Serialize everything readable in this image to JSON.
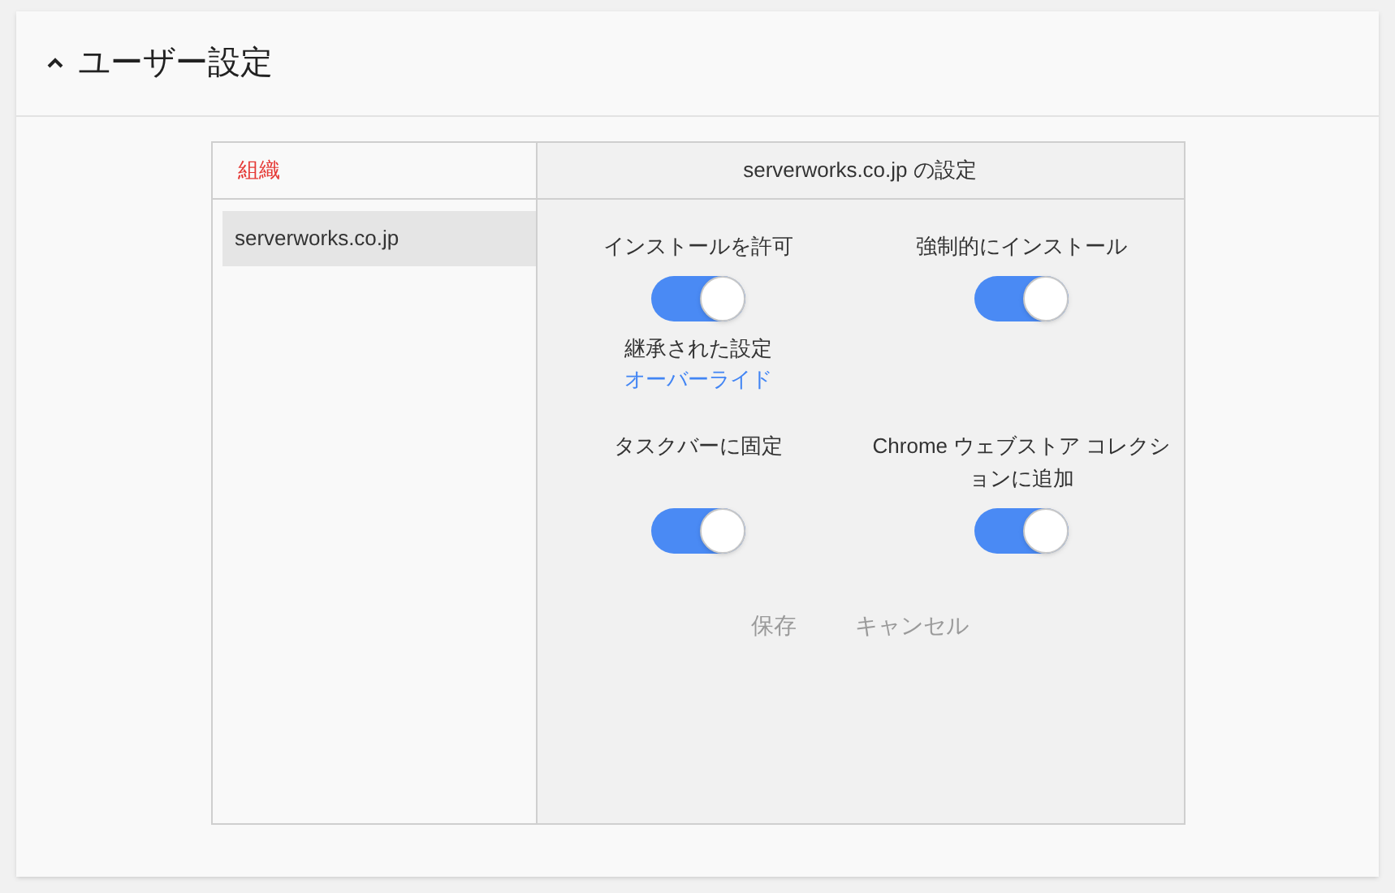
{
  "section": {
    "title": "ユーザー設定",
    "expanded": true
  },
  "org_panel": {
    "header": "組織",
    "items": [
      {
        "label": "serverworks.co.jp",
        "selected": true
      }
    ]
  },
  "settings_panel": {
    "title": "serverworks.co.jp の設定",
    "settings": [
      {
        "label": "インストールを許可",
        "on": true,
        "note": "継承された設定",
        "link": "オーバーライド"
      },
      {
        "label": "強制的にインストール",
        "on": true
      },
      {
        "label": "タスクバーに固定",
        "on": true
      },
      {
        "label": "Chrome ウェブストア コレクションに追加",
        "on": true
      }
    ],
    "buttons": [
      {
        "label": "保存",
        "disabled": true
      },
      {
        "label": "キャンセル",
        "disabled": true
      }
    ]
  }
}
